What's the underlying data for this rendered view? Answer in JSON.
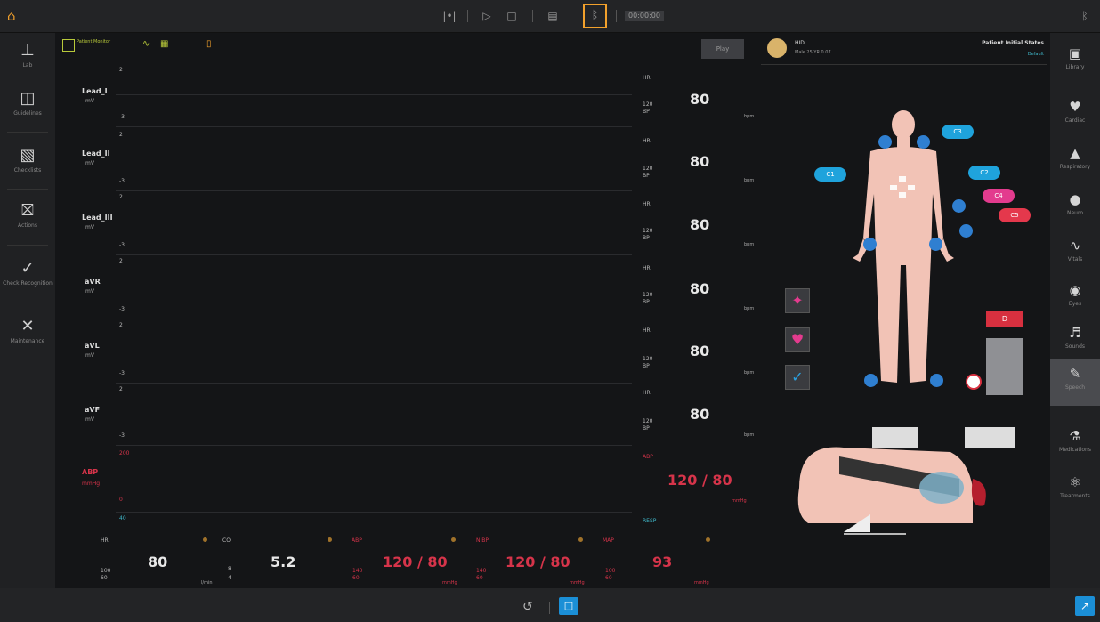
{
  "topbar": {
    "home_icon": "home-icon",
    "icons": [
      "signal-icon",
      "play-icon",
      "square-icon",
      "save-icon"
    ],
    "bluetooth_icon": "bluetooth-icon",
    "clock": "00:00:00",
    "bt_right_icon": "bluetooth-icon"
  },
  "leftnav": [
    {
      "label": "Lab",
      "icon": "lab-icon"
    },
    {
      "label": "Guidelines",
      "icon": "guidelines-icon"
    },
    {
      "label": "Checklists",
      "icon": "checklists-icon"
    },
    {
      "label": "Actions",
      "icon": "actions-icon"
    },
    {
      "label": "Check Recognition",
      "icon": "check-icon"
    },
    {
      "label": "Maintenance",
      "icon": "maintenance-icon"
    }
  ],
  "rightnav": [
    {
      "label": "Library",
      "icon": "library-icon"
    },
    {
      "label": "Cardiac",
      "icon": "cardiac-icon"
    },
    {
      "label": "Respiratory",
      "icon": "respiratory-icon"
    },
    {
      "label": "Neuro",
      "icon": "neuro-icon"
    },
    {
      "label": "Vitals",
      "icon": "vitals-icon"
    },
    {
      "label": "Eyes",
      "icon": "eyes-icon"
    },
    {
      "label": "Sounds",
      "icon": "sounds-icon"
    },
    {
      "label": "Speech",
      "icon": "speech-icon"
    },
    {
      "label": "Medications",
      "icon": "medications-icon"
    },
    {
      "label": "Treatments",
      "icon": "treatments-icon"
    }
  ],
  "monitor_toolbar": {
    "label": "Patient Monitor"
  },
  "patient": {
    "button": "Play",
    "name": "HID",
    "subtitle": "Male 25 YR 0 07",
    "status_title": "Patient Initial States",
    "status_link": "Default"
  },
  "waves": [
    {
      "name": "Lead_I",
      "unit": "mV",
      "top": "2",
      "bottom": "-3",
      "hr_label": "HR",
      "hr_value": "80",
      "sec1": "120",
      "sec2": "BP",
      "unit_r": "bpm"
    },
    {
      "name": "Lead_II",
      "unit": "mV",
      "top": "2",
      "bottom": "-3",
      "hr_label": "HR",
      "hr_value": "80",
      "sec1": "120",
      "sec2": "BP",
      "unit_r": "bpm"
    },
    {
      "name": "Lead_III",
      "unit": "mV",
      "top": "2",
      "bottom": "-3",
      "hr_label": "HR",
      "hr_value": "80",
      "sec1": "120",
      "sec2": "BP",
      "unit_r": "bpm"
    },
    {
      "name": "aVR",
      "unit": "mV",
      "top": "2",
      "bottom": "-3",
      "hr_label": "HR",
      "hr_value": "80",
      "sec1": "120",
      "sec2": "BP",
      "unit_r": "bpm"
    },
    {
      "name": "aVL",
      "unit": "mV",
      "top": "2",
      "bottom": "-3",
      "hr_label": "HR",
      "hr_value": "80",
      "sec1": "120",
      "sec2": "BP",
      "unit_r": "bpm"
    },
    {
      "name": "aVF",
      "unit": "mV",
      "top": "2",
      "bottom": "-3",
      "hr_label": "HR",
      "hr_value": "80",
      "sec1": "120",
      "sec2": "BP",
      "unit_r": "bpm"
    }
  ],
  "abp": {
    "name": "ABP",
    "unit": "mmHg",
    "top": "200",
    "bottom": "0",
    "label": "ABP",
    "value": "120 / 80",
    "unit_r": "mmHg"
  },
  "resp": {
    "top_left": "40",
    "label": "RESP"
  },
  "bottom_vitals": [
    {
      "label": "HR",
      "value": "80",
      "sub1": "100",
      "sub2": "60",
      "unit": ""
    },
    {
      "label": "CO",
      "value": "5.2",
      "sub1": "8",
      "sub2": "4",
      "unit": "l/min"
    },
    {
      "label": "ABP",
      "value": "120 / 80",
      "sub1": "140",
      "sub2": "60",
      "unit": "mmHg"
    },
    {
      "label": "NIBP",
      "value": "120 / 80",
      "sub1": "140",
      "sub2": "60",
      "unit": "mmHg"
    },
    {
      "label": "MAP",
      "value": "93",
      "sub1": "100",
      "sub2": "60",
      "unit": "mmHg"
    }
  ],
  "body_pills": [
    "C3",
    "C1",
    "C2",
    "C4",
    "C5"
  ],
  "defib_label": "D",
  "tools": [
    "shock-icon",
    "heart-icon",
    "check-icon"
  ],
  "bottombar": {
    "left_icon": "history-icon",
    "right_icon": "chat-icon",
    "expand_icon": "expand-icon"
  }
}
